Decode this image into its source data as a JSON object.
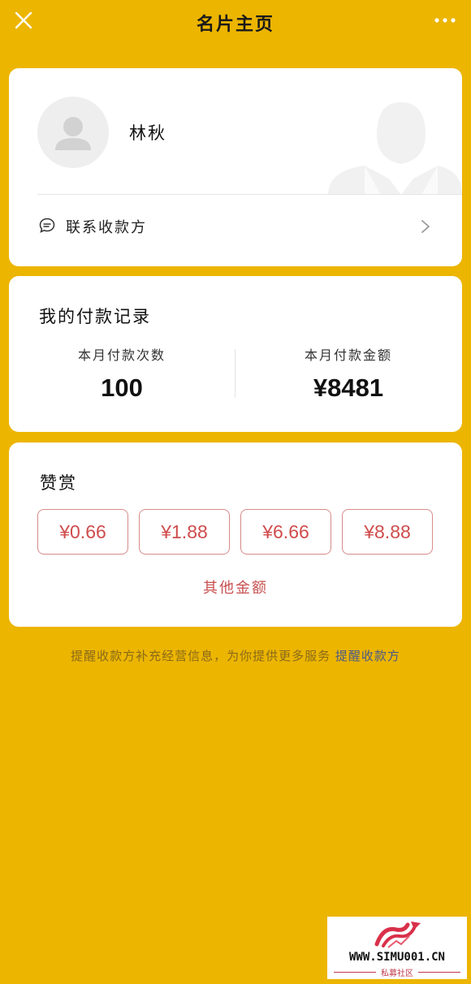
{
  "nav": {
    "title": "名片主页",
    "close_icon": "close-icon",
    "more_icon": "more-dots-icon"
  },
  "profile": {
    "name": "林秋",
    "contact_label": "联系收款方",
    "contact_icon": "chat-bubble-icon"
  },
  "records": {
    "title": "我的付款记录",
    "count_label": "本月付款次数",
    "count_value": "100",
    "amount_label": "本月付款金额",
    "amount_value": "¥8481"
  },
  "tip": {
    "title": "赞赏",
    "options": [
      "¥0.66",
      "¥1.88",
      "¥6.66",
      "¥8.88"
    ],
    "other_label": "其他金额"
  },
  "hint": {
    "text": "提醒收款方补充经营信息，为你提供更多服务",
    "link": "提醒收款方"
  },
  "stamp": {
    "url": "WWW.SIMU001.CN",
    "sub": "私募社区"
  },
  "colors": {
    "background": "#ECB500",
    "card": "#FFFFFF",
    "tip_text": "#D04C4C",
    "link": "#4A5A8A"
  }
}
